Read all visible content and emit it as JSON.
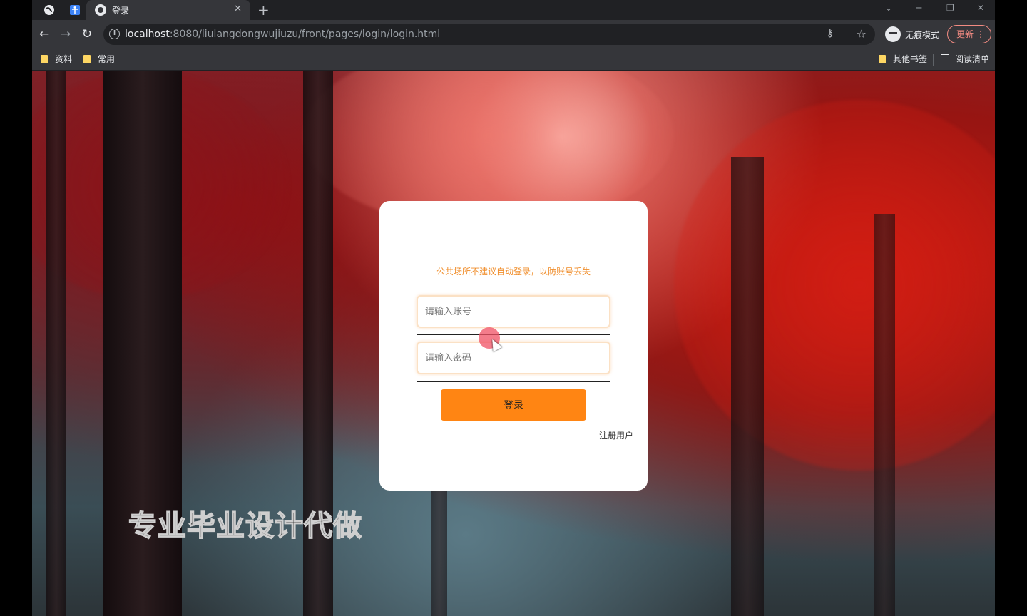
{
  "browser": {
    "tab_title": "登录",
    "url_host": "localhost",
    "url_rest": ":8080/liulangdongwujiuzu/front/pages/login/login.html",
    "incognito_label": "无痕模式",
    "update_label": "更新"
  },
  "bookmarks": {
    "left": [
      "资料",
      "常用"
    ],
    "other": "其他书签",
    "reading_list": "阅读清单"
  },
  "login": {
    "notice": "公共场所不建议自动登录，以防账号丢失",
    "account_placeholder": "请输入账号",
    "password_placeholder": "请输入密码",
    "login_button": "登录",
    "register_link": "注册用户"
  },
  "watermark": "专业毕业设计代做",
  "colors": {
    "accent": "#ff8513",
    "notice": "#f08d2a"
  }
}
